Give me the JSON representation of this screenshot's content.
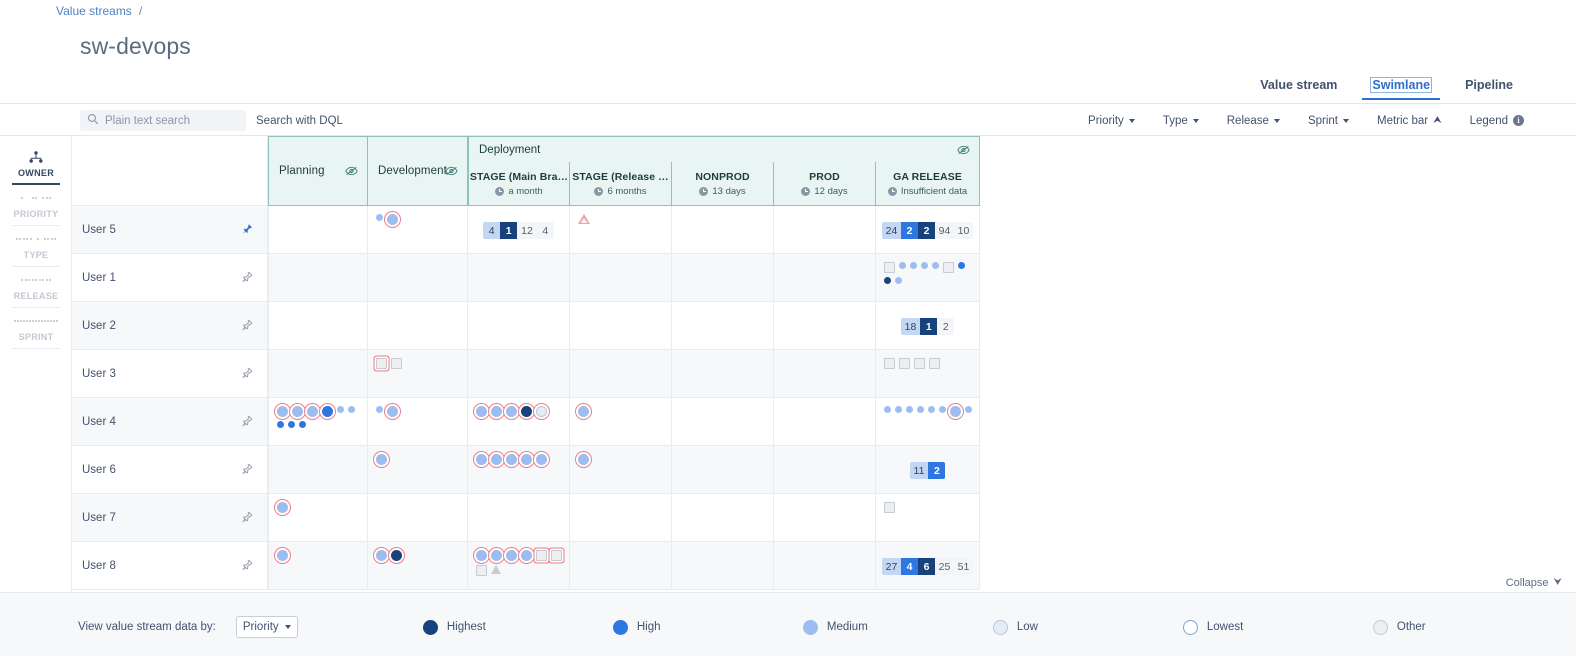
{
  "breadcrumb": {
    "root": "Value streams",
    "separator": "/"
  },
  "page_title": "sw-devops",
  "view_tabs": [
    {
      "label": "Value stream",
      "active": false
    },
    {
      "label": "Swimlane",
      "active": true
    },
    {
      "label": "Pipeline",
      "active": false
    }
  ],
  "toolbar": {
    "search_placeholder": "Plain text search",
    "search_value": "",
    "search_icon": "search-icon",
    "dql_link": "Search with DQL",
    "filters": [
      {
        "label": "Priority",
        "type": "dropdown"
      },
      {
        "label": "Type",
        "type": "dropdown"
      },
      {
        "label": "Release",
        "type": "dropdown"
      },
      {
        "label": "Sprint",
        "type": "dropdown"
      },
      {
        "label": "Metric bar",
        "type": "toggle",
        "icon": "chevron-up-icon"
      },
      {
        "label": "Legend",
        "type": "info",
        "icon": "info-icon"
      }
    ]
  },
  "rail": {
    "items": [
      {
        "label": "OWNER",
        "icon": "owner-group-icon",
        "active": true
      },
      {
        "label": "PRIORITY",
        "icon": "priority-dots-icon",
        "active": false
      },
      {
        "label": "TYPE",
        "icon": "type-dots-icon",
        "active": false
      },
      {
        "label": "RELEASE",
        "icon": "release-dots-icon",
        "active": false
      },
      {
        "label": "SPRINT",
        "icon": "sprint-dots-icon",
        "active": false
      }
    ]
  },
  "grid": {
    "group_header": {
      "label": "Deployment",
      "eye_icon": "eye-off-icon"
    },
    "columns": [
      {
        "key": "planning",
        "name": "Planning",
        "meta": "",
        "eye_icon": "eye-off-icon",
        "grouped": false
      },
      {
        "key": "development",
        "name": "Development",
        "meta": "",
        "eye_icon": "eye-off-icon",
        "grouped": false
      },
      {
        "key": "stage_main",
        "name": "STAGE (Main Bra…",
        "meta": "a month",
        "grouped": true
      },
      {
        "key": "stage_release",
        "name": "STAGE (Release …",
        "meta": "6 months",
        "grouped": true
      },
      {
        "key": "nonprod",
        "name": "NONPROD",
        "meta": "13 days",
        "grouped": true
      },
      {
        "key": "prod",
        "name": "PROD",
        "meta": "12 days",
        "grouped": true
      },
      {
        "key": "ga_release",
        "name": "GA RELEASE",
        "meta": "Insufficient data",
        "grouped": true
      }
    ],
    "rows": [
      {
        "owner": "User 5",
        "pin": {
          "icon": "pin-icon",
          "pinned": true
        },
        "cells": {
          "planning": {
            "tokens": []
          },
          "development": {
            "tokens": [
              {
                "shape": "circle",
                "priority": "medium",
                "small": true
              },
              {
                "shape": "circle",
                "priority": "medium",
                "blocked": true
              }
            ]
          },
          "stage_main": {
            "metric_bar": [
              {
                "value": "4",
                "style": "medium"
              },
              {
                "value": "1",
                "style": "highest"
              },
              {
                "value": "12",
                "style": "pale"
              },
              {
                "value": "4",
                "style": "pale"
              }
            ]
          },
          "stage_release": {
            "tokens": [
              {
                "shape": "triangle",
                "priority": "warning"
              }
            ]
          },
          "nonprod": {
            "tokens": []
          },
          "prod": {
            "tokens": []
          },
          "ga_release": {
            "metric_bar": [
              {
                "value": "24",
                "style": "medium"
              },
              {
                "value": "2",
                "style": "high"
              },
              {
                "value": "2",
                "style": "highest"
              },
              {
                "value": "94",
                "style": "pale"
              },
              {
                "value": "10",
                "style": "pale"
              }
            ]
          }
        }
      },
      {
        "owner": "User 1",
        "pin": {
          "icon": "pin-icon",
          "pinned": false
        },
        "cells": {
          "planning": {
            "tokens": []
          },
          "development": {
            "tokens": []
          },
          "stage_main": {
            "tokens": []
          },
          "stage_release": {
            "tokens": []
          },
          "nonprod": {
            "tokens": []
          },
          "prod": {
            "tokens": []
          },
          "ga_release": {
            "tokens": [
              {
                "shape": "square",
                "priority": "other"
              },
              {
                "shape": "circle",
                "priority": "medium",
                "small": true
              },
              {
                "shape": "circle",
                "priority": "medium",
                "small": true
              },
              {
                "shape": "circle",
                "priority": "medium",
                "small": true
              },
              {
                "shape": "circle",
                "priority": "medium",
                "small": true
              },
              {
                "shape": "square",
                "priority": "other"
              },
              {
                "shape": "circle",
                "priority": "high",
                "small": true
              },
              {
                "shape": "circle",
                "priority": "highest",
                "small": true
              },
              {
                "shape": "circle",
                "priority": "medium",
                "small": true
              }
            ]
          }
        }
      },
      {
        "owner": "User 2",
        "pin": {
          "icon": "pin-icon",
          "pinned": false
        },
        "cells": {
          "planning": {
            "tokens": []
          },
          "development": {
            "tokens": []
          },
          "stage_main": {
            "tokens": []
          },
          "stage_release": {
            "tokens": []
          },
          "nonprod": {
            "tokens": []
          },
          "prod": {
            "tokens": []
          },
          "ga_release": {
            "metric_bar": [
              {
                "value": "18",
                "style": "medium"
              },
              {
                "value": "1",
                "style": "highest"
              },
              {
                "value": "2",
                "style": "pale"
              }
            ]
          }
        }
      },
      {
        "owner": "User 3",
        "pin": {
          "icon": "pin-icon",
          "pinned": false
        },
        "cells": {
          "planning": {
            "tokens": []
          },
          "development": {
            "tokens": [
              {
                "shape": "square",
                "priority": "other",
                "blocked": true
              },
              {
                "shape": "square",
                "priority": "other"
              }
            ]
          },
          "stage_main": {
            "tokens": []
          },
          "stage_release": {
            "tokens": []
          },
          "nonprod": {
            "tokens": []
          },
          "prod": {
            "tokens": []
          },
          "ga_release": {
            "tokens": [
              {
                "shape": "square",
                "priority": "other"
              },
              {
                "shape": "square",
                "priority": "other"
              },
              {
                "shape": "square",
                "priority": "other"
              },
              {
                "shape": "square",
                "priority": "other"
              }
            ]
          }
        }
      },
      {
        "owner": "User 4",
        "pin": {
          "icon": "pin-icon",
          "pinned": false
        },
        "cells": {
          "planning": {
            "tokens": [
              {
                "shape": "circle",
                "priority": "medium",
                "blocked": true
              },
              {
                "shape": "circle",
                "priority": "medium",
                "blocked": true
              },
              {
                "shape": "circle",
                "priority": "medium",
                "blocked": true
              },
              {
                "shape": "circle",
                "priority": "high",
                "blocked": true
              },
              {
                "shape": "circle",
                "priority": "medium",
                "small": true
              },
              {
                "shape": "circle",
                "priority": "medium",
                "small": true
              },
              {
                "shape": "circle",
                "priority": "high",
                "small": true
              },
              {
                "shape": "circle",
                "priority": "high",
                "small": true
              },
              {
                "shape": "circle",
                "priority": "high",
                "small": true
              }
            ]
          },
          "development": {
            "tokens": [
              {
                "shape": "circle",
                "priority": "medium",
                "small": true
              },
              {
                "shape": "circle",
                "priority": "medium",
                "blocked": true
              }
            ]
          },
          "stage_main": {
            "tokens": [
              {
                "shape": "circle",
                "priority": "medium",
                "blocked": true
              },
              {
                "shape": "circle",
                "priority": "medium",
                "blocked": true
              },
              {
                "shape": "circle",
                "priority": "medium",
                "blocked": true
              },
              {
                "shape": "circle",
                "priority": "highest",
                "blocked": true
              },
              {
                "shape": "circle",
                "priority": "low",
                "blocked": true
              }
            ]
          },
          "stage_release": {
            "tokens": [
              {
                "shape": "circle",
                "priority": "medium",
                "blocked": true
              }
            ]
          },
          "nonprod": {
            "tokens": []
          },
          "prod": {
            "tokens": []
          },
          "ga_release": {
            "tokens": [
              {
                "shape": "circle",
                "priority": "medium",
                "small": true
              },
              {
                "shape": "circle",
                "priority": "medium",
                "small": true
              },
              {
                "shape": "circle",
                "priority": "medium",
                "small": true
              },
              {
                "shape": "circle",
                "priority": "medium",
                "small": true
              },
              {
                "shape": "circle",
                "priority": "medium",
                "small": true
              },
              {
                "shape": "circle",
                "priority": "medium",
                "small": true
              },
              {
                "shape": "circle",
                "priority": "medium",
                "blocked": true
              },
              {
                "shape": "circle",
                "priority": "medium",
                "small": true
              }
            ]
          }
        }
      },
      {
        "owner": "User 6",
        "pin": {
          "icon": "pin-icon",
          "pinned": false
        },
        "cells": {
          "planning": {
            "tokens": []
          },
          "development": {
            "tokens": [
              {
                "shape": "circle",
                "priority": "medium",
                "blocked": true
              }
            ]
          },
          "stage_main": {
            "tokens": [
              {
                "shape": "circle",
                "priority": "medium",
                "blocked": true
              },
              {
                "shape": "circle",
                "priority": "medium",
                "blocked": true
              },
              {
                "shape": "circle",
                "priority": "medium",
                "blocked": true
              },
              {
                "shape": "circle",
                "priority": "medium",
                "blocked": true
              },
              {
                "shape": "circle",
                "priority": "medium",
                "blocked": true
              }
            ]
          },
          "stage_release": {
            "tokens": [
              {
                "shape": "circle",
                "priority": "medium",
                "blocked": true
              }
            ]
          },
          "nonprod": {
            "tokens": []
          },
          "prod": {
            "tokens": []
          },
          "ga_release": {
            "metric_bar": [
              {
                "value": "11",
                "style": "medium"
              },
              {
                "value": "2",
                "style": "high"
              }
            ]
          }
        }
      },
      {
        "owner": "User 7",
        "pin": {
          "icon": "pin-icon",
          "pinned": false
        },
        "cells": {
          "planning": {
            "tokens": [
              {
                "shape": "circle",
                "priority": "medium",
                "blocked": true
              }
            ]
          },
          "development": {
            "tokens": []
          },
          "stage_main": {
            "tokens": []
          },
          "stage_release": {
            "tokens": []
          },
          "nonprod": {
            "tokens": []
          },
          "prod": {
            "tokens": []
          },
          "ga_release": {
            "tokens": [
              {
                "shape": "square",
                "priority": "other"
              }
            ]
          }
        }
      },
      {
        "owner": "User 8",
        "pin": {
          "icon": "pin-icon",
          "pinned": false
        },
        "cells": {
          "planning": {
            "tokens": [
              {
                "shape": "circle",
                "priority": "medium",
                "blocked": true
              }
            ]
          },
          "development": {
            "tokens": [
              {
                "shape": "circle",
                "priority": "medium",
                "blocked": true
              },
              {
                "shape": "circle",
                "priority": "highest",
                "blocked": true
              }
            ]
          },
          "stage_main": {
            "tokens": [
              {
                "shape": "circle",
                "priority": "medium",
                "blocked": true
              },
              {
                "shape": "circle",
                "priority": "medium",
                "blocked": true
              },
              {
                "shape": "circle",
                "priority": "medium",
                "blocked": true
              },
              {
                "shape": "circle",
                "priority": "medium",
                "blocked": true
              },
              {
                "shape": "square",
                "priority": "other",
                "blocked": true
              },
              {
                "shape": "square",
                "priority": "other",
                "blocked": true
              },
              {
                "shape": "square",
                "priority": "other"
              },
              {
                "shape": "triangle",
                "priority": "other"
              }
            ]
          },
          "stage_release": {
            "tokens": []
          },
          "nonprod": {
            "tokens": []
          },
          "prod": {
            "tokens": []
          },
          "ga_release": {
            "metric_bar": [
              {
                "value": "27",
                "style": "medium"
              },
              {
                "value": "4",
                "style": "high"
              },
              {
                "value": "6",
                "style": "highest"
              },
              {
                "value": "25",
                "style": "pale"
              },
              {
                "value": "51",
                "style": "pale"
              }
            ]
          }
        }
      }
    ]
  },
  "footer": {
    "collapse_label": "Collapse",
    "collapse_icon": "chevron-down-icon",
    "view_by_label": "View value stream data by:",
    "view_by_value": "Priority",
    "legend": [
      {
        "label": "Highest",
        "color": "#17427c",
        "key": "highest"
      },
      {
        "label": "High",
        "color": "#2f77e0",
        "key": "high"
      },
      {
        "label": "Medium",
        "color": "#9dbdf0",
        "key": "medium"
      },
      {
        "label": "Low",
        "color": "#e4ecf8",
        "key": "low"
      },
      {
        "label": "Lowest",
        "color": "#ffffff",
        "key": "lowest"
      },
      {
        "label": "Other",
        "color": "#eceef1",
        "key": "other"
      }
    ]
  },
  "colors": {
    "accent": "#2f6fcb",
    "header_band": "#e9f5f3",
    "header_border": "#8fc2bd",
    "blocked_ring": "#ef7c86",
    "warning": "#f2a0a6"
  }
}
